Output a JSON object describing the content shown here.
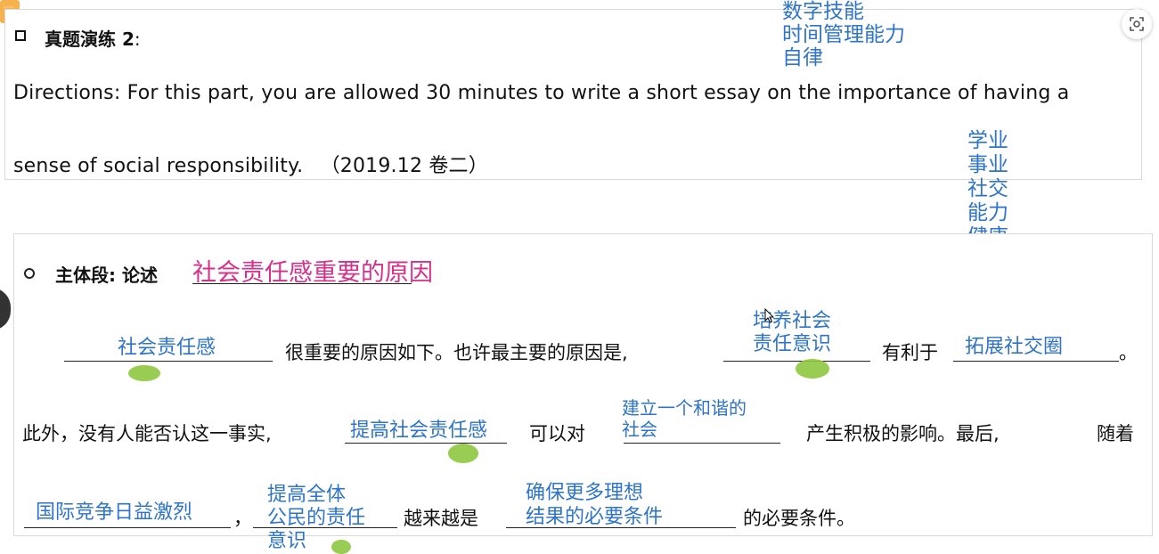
{
  "sticky_icon": "note-icon",
  "question": {
    "label": "真题演练 2",
    "colon": ":",
    "directions_line1": "Directions: For this part, you are allowed 30 minutes to write a short essay on the importance of having a",
    "directions_line2": "sense of social responsibility.",
    "source": "（2019.12 卷二）"
  },
  "notes_top": [
    "数字技能",
    "时间管理能力",
    "自律"
  ],
  "notes_right": [
    "学业",
    "事业",
    "社交",
    "能力",
    "健康"
  ],
  "body": {
    "heading": "主体段: 论述",
    "heading_handwritten": "社会责任感重要的原因",
    "line1": {
      "fill1": "社会责任感",
      "text1": "很重要的原因如下。也许最主要的原因是,",
      "fill2a": "培养社会",
      "fill2b": "责任意识",
      "text2": "有利于",
      "fill3": "拓展社交圈",
      "end": "。"
    },
    "line2": {
      "text1": "此外，没有人能否认这一事实,",
      "fill1": "提高社会责任感",
      "text2": "可以对",
      "fill2a": "建立一个和谐的",
      "fill2b": "社会",
      "text3": "产生积极的影响。最后,",
      "text4": "随着"
    },
    "line3": {
      "fill1": "国际竞争日益激烈",
      "comma": "，",
      "fill2a": "提高全体",
      "fill2b": "公民的责任",
      "fill2c": "意识",
      "text1": "越来越是",
      "fill3a": "确保更多理想",
      "fill3b": "结果的必要条件",
      "text2": "的必要条件。"
    }
  },
  "colors": {
    "handwriting_blue": "#2f74c7",
    "handwriting_pink": "#d6318a",
    "highlight_green": "#8ec63f"
  }
}
